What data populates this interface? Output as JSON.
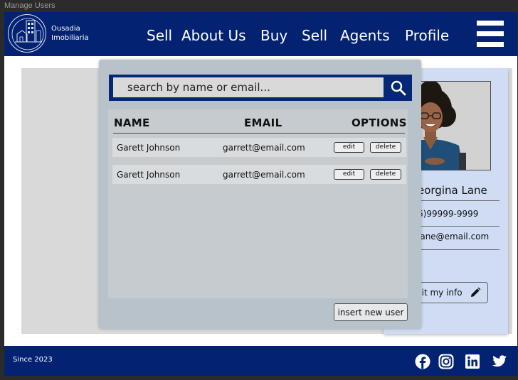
{
  "window": {
    "title": "Manage Users"
  },
  "brand": {
    "name_line1": "Ousadia",
    "name_line2": "Imobiliaria"
  },
  "nav": {
    "items": [
      "Sell",
      "About Us",
      "Buy",
      "Sell",
      "Agents",
      "Profile"
    ]
  },
  "profile": {
    "name": "eorgina Lane",
    "phone": "6)99999-9999",
    "email": "lane@email.com",
    "edit_label": "dit my info"
  },
  "modal": {
    "search": {
      "placeholder": "search by name or email..."
    },
    "table": {
      "headers": [
        "NAME",
        "EMAIL",
        "OPTIONS"
      ],
      "rows": [
        {
          "name": "Garett Johnson",
          "email": "garrett@email.com",
          "edit": "edit",
          "delete": "delete"
        },
        {
          "name": "Garett Johnson",
          "email": "garrett@email.com",
          "edit": "edit",
          "delete": "delete"
        }
      ]
    },
    "insert_label": "insert new user"
  },
  "footer": {
    "since": "Since 2023"
  },
  "icons": {
    "search": "search-icon",
    "edit": "pencil-icon",
    "menu": "hamburger-icon",
    "social": [
      "facebook-icon",
      "instagram-icon",
      "linkedin-icon",
      "twitter-icon"
    ]
  },
  "colors": {
    "primary": "#032271",
    "modal_bg": "#b8c2ca",
    "card_bg": "#cfdcf3",
    "panel_bg": "#d9d9d9"
  }
}
